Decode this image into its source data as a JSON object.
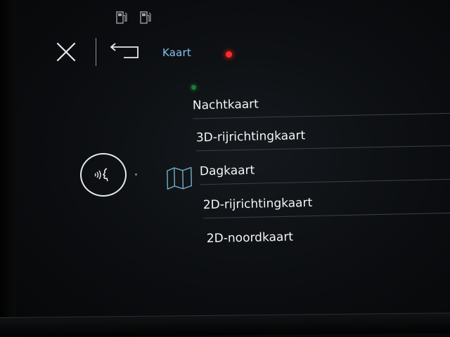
{
  "header": {
    "breadcrumb": "Kaart",
    "icons": [
      "fuel-pump-icon",
      "fuel-pump-icon",
      "close-icon",
      "back-arrow-icon"
    ]
  },
  "side": {
    "voice_icon": "voice-command-icon"
  },
  "menu": {
    "selected_index": 2,
    "selected_icon": "map-icon",
    "items": [
      {
        "label": "Nachtkaart"
      },
      {
        "label": "3D-rijrichtingkaart"
      },
      {
        "label": "Dagkaart"
      },
      {
        "label": "2D-rijrichtingkaart"
      },
      {
        "label": "2D-noordkaart"
      }
    ]
  },
  "colors": {
    "accent": "#7fc4e8",
    "text": "#f3f4f5",
    "icon": "#e6e9ec",
    "map_icon": "#6fa6c4",
    "led_red": "#ff2a2a",
    "led_green": "#1e7a32",
    "background": "#0b0d10"
  }
}
